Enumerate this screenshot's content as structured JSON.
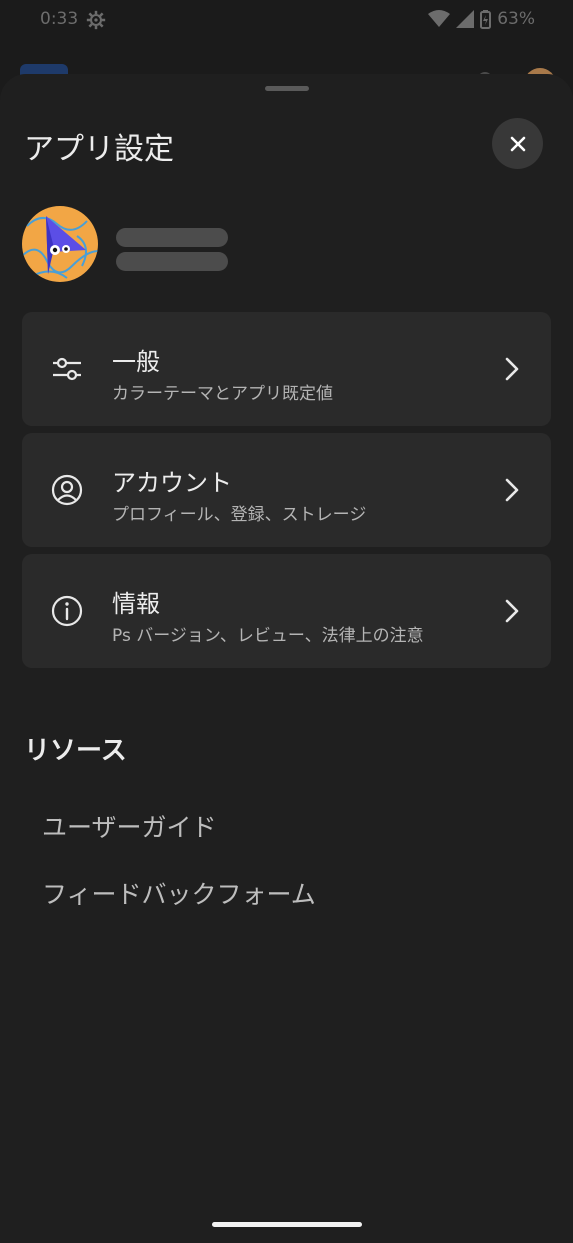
{
  "status_bar": {
    "time": "0:33",
    "battery": "63%"
  },
  "sheet": {
    "title": "アプリ設定",
    "close_icon": "close-icon"
  },
  "profile": {
    "avatar_icon": "avatar-image"
  },
  "menu": [
    {
      "id": "general",
      "icon": "sliders-icon",
      "label": "一般",
      "sub": "カラーテーマとアプリ既定値"
    },
    {
      "id": "account",
      "icon": "account-circle-icon",
      "label": "アカウント",
      "sub": "プロフィール、登録、ストレージ"
    },
    {
      "id": "info",
      "icon": "info-icon",
      "label": "情報",
      "sub": "Ps バージョン、レビュー、法律上の注意"
    }
  ],
  "resources": {
    "title": "リソース",
    "links": [
      "ユーザーガイド",
      "フィードバックフォーム"
    ]
  },
  "colors": {
    "background": "#1f1f1f",
    "card": "#2a2a2a",
    "close_button": "#383838",
    "avatar_bg": "#f2a645",
    "avatar_accent": "#5b4ee6"
  }
}
